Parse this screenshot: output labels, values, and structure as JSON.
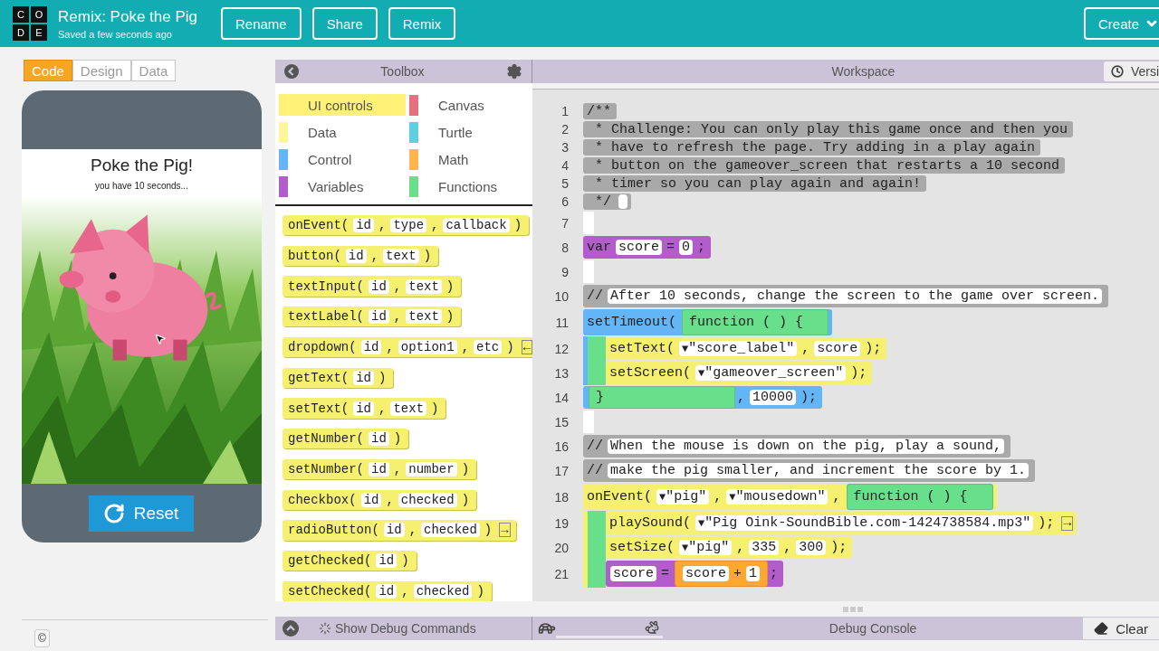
{
  "header": {
    "logo_letters": [
      "C",
      "O",
      "D",
      "E"
    ],
    "title": "Remix: Poke the Pig",
    "subtitle": "Saved a few seconds ago",
    "buttons": [
      "Rename",
      "Share",
      "Remix"
    ],
    "create_button": "Create"
  },
  "view_tabs": [
    {
      "label": "Code",
      "selected": true
    },
    {
      "label": "Design",
      "selected": false
    },
    {
      "label": "Data",
      "selected": false
    }
  ],
  "app_preview": {
    "title": "Poke the Pig!",
    "timer_text": "you have 10 seconds...",
    "reset_button": "Reset",
    "copyright_button": "©"
  },
  "toolbox": {
    "title": "Toolbox",
    "categories": [
      {
        "label": "UI controls",
        "color": "#fff176",
        "selected": true
      },
      {
        "label": "Canvas",
        "color": "#e5707e",
        "selected": false
      },
      {
        "label": "Data",
        "color": "#fff59d",
        "selected": false
      },
      {
        "label": "Turtle",
        "color": "#5ed0e0",
        "selected": false
      },
      {
        "label": "Control",
        "color": "#64b5f6",
        "selected": false
      },
      {
        "label": "Math",
        "color": "#ffb74d",
        "selected": false
      },
      {
        "label": "Variables",
        "color": "#b35ccc",
        "selected": false
      },
      {
        "label": "Functions",
        "color": "#68e08b",
        "selected": false
      }
    ],
    "blocks": [
      [
        {
          "kind": "code",
          "text": "onEvent("
        },
        {
          "kind": "slot",
          "text": "id"
        },
        {
          "kind": "code",
          "text": ","
        },
        {
          "kind": "slot",
          "text": "type"
        },
        {
          "kind": "code",
          "text": ","
        },
        {
          "kind": "slot",
          "text": "callback"
        },
        {
          "kind": "code",
          "text": ")"
        }
      ],
      [
        {
          "kind": "code",
          "text": "button("
        },
        {
          "kind": "slot",
          "text": "id"
        },
        {
          "kind": "code",
          "text": ","
        },
        {
          "kind": "slot",
          "text": "text"
        },
        {
          "kind": "code",
          "text": ")"
        }
      ],
      [
        {
          "kind": "code",
          "text": "textInput("
        },
        {
          "kind": "slot",
          "text": "id"
        },
        {
          "kind": "code",
          "text": ","
        },
        {
          "kind": "slot",
          "text": "text"
        },
        {
          "kind": "code",
          "text": ")"
        }
      ],
      [
        {
          "kind": "code",
          "text": "textLabel("
        },
        {
          "kind": "slot",
          "text": "id"
        },
        {
          "kind": "code",
          "text": ","
        },
        {
          "kind": "slot",
          "text": "text"
        },
        {
          "kind": "code",
          "text": ")"
        }
      ],
      [
        {
          "kind": "code",
          "text": "dropdown("
        },
        {
          "kind": "slot",
          "text": "id"
        },
        {
          "kind": "code",
          "text": ","
        },
        {
          "kind": "slot",
          "text": "option1"
        },
        {
          "kind": "code",
          "text": ","
        },
        {
          "kind": "slot",
          "text": "etc"
        },
        {
          "kind": "code",
          "text": ")"
        },
        {
          "kind": "arrow",
          "text": "←"
        }
      ],
      [
        {
          "kind": "code",
          "text": "getText("
        },
        {
          "kind": "slot",
          "text": "id"
        },
        {
          "kind": "code",
          "text": ")"
        }
      ],
      [
        {
          "kind": "code",
          "text": "setText("
        },
        {
          "kind": "slot",
          "text": "id"
        },
        {
          "kind": "code",
          "text": ","
        },
        {
          "kind": "slot",
          "text": "text"
        },
        {
          "kind": "code",
          "text": ")"
        }
      ],
      [
        {
          "kind": "code",
          "text": "getNumber("
        },
        {
          "kind": "slot",
          "text": "id"
        },
        {
          "kind": "code",
          "text": ")"
        }
      ],
      [
        {
          "kind": "code",
          "text": "setNumber("
        },
        {
          "kind": "slot",
          "text": "id"
        },
        {
          "kind": "code",
          "text": ","
        },
        {
          "kind": "slot",
          "text": "number"
        },
        {
          "kind": "code",
          "text": ")"
        }
      ],
      [
        {
          "kind": "code",
          "text": "checkbox("
        },
        {
          "kind": "slot",
          "text": "id"
        },
        {
          "kind": "code",
          "text": ","
        },
        {
          "kind": "slot",
          "text": "checked"
        },
        {
          "kind": "code",
          "text": ")"
        }
      ],
      [
        {
          "kind": "code",
          "text": "radioButton("
        },
        {
          "kind": "slot",
          "text": "id"
        },
        {
          "kind": "code",
          "text": ","
        },
        {
          "kind": "slot",
          "text": "checked"
        },
        {
          "kind": "code",
          "text": ")"
        },
        {
          "kind": "arrow",
          "text": "→"
        }
      ],
      [
        {
          "kind": "code",
          "text": "getChecked("
        },
        {
          "kind": "slot",
          "text": "id"
        },
        {
          "kind": "code",
          "text": ")"
        }
      ],
      [
        {
          "kind": "code",
          "text": "setChecked("
        },
        {
          "kind": "slot",
          "text": "id"
        },
        {
          "kind": "code",
          "text": ","
        },
        {
          "kind": "slot",
          "text": "checked"
        },
        {
          "kind": "code",
          "text": ")"
        }
      ]
    ]
  },
  "workspace": {
    "title": "Workspace",
    "version_button": "Versi",
    "lines": [
      {
        "number": "1",
        "kind": "doc",
        "tokens": [
          {
            "kind": "code",
            "text": "/**"
          }
        ]
      },
      {
        "number": "2",
        "kind": "doc",
        "tokens": [
          {
            "kind": "code",
            "text": " * Challenge: You can only play this game once and then you"
          }
        ]
      },
      {
        "number": "3",
        "kind": "doc",
        "tokens": [
          {
            "kind": "code",
            "text": " * have to refresh the page. Try adding in a play again"
          }
        ]
      },
      {
        "number": "4",
        "kind": "doc",
        "tokens": [
          {
            "kind": "code",
            "text": " * button on the gameover_screen that restarts a 10 second"
          }
        ]
      },
      {
        "number": "5",
        "kind": "doc",
        "tokens": [
          {
            "kind": "code",
            "text": " * timer so you can play again and again!"
          }
        ]
      },
      {
        "number": "6",
        "kind": "doc",
        "tokens": [
          {
            "kind": "code",
            "text": " */"
          },
          {
            "kind": "blank"
          }
        ]
      },
      {
        "number": "7",
        "kind": "spacer"
      },
      {
        "number": "8",
        "kind": "block",
        "color": "#b35ccc",
        "tokens": [
          {
            "kind": "code",
            "text": "var"
          },
          {
            "kind": "slot",
            "text": "score"
          },
          {
            "kind": "code",
            "text": "="
          },
          {
            "kind": "slot",
            "text": "0"
          },
          {
            "kind": "code",
            "text": ";"
          }
        ]
      },
      {
        "number": "9",
        "kind": "spacer"
      },
      {
        "number": "10",
        "kind": "block",
        "color": "#a9a9a9",
        "tokens": [
          {
            "kind": "code",
            "text": "//"
          },
          {
            "kind": "slot",
            "text": "After 10 seconds, change the screen to the game over screen."
          }
        ]
      },
      {
        "number": "11",
        "kind": "block",
        "color": "#64b5f6",
        "tokens": [
          {
            "kind": "code",
            "text": "setTimeout("
          },
          {
            "kind": "block",
            "color": "#68e08b",
            "tokens": [
              {
                "kind": "code",
                "text": "function ( ) {"
              }
            ]
          }
        ],
        "children": [
          {
            "number": "12",
            "kind": "block",
            "color": "#f6f070",
            "tokens": [
              {
                "kind": "code",
                "text": "setText("
              },
              {
                "kind": "dropdown",
                "arrow": "▼",
                "text": "\"score_label\""
              },
              {
                "kind": "code",
                "text": ","
              },
              {
                "kind": "slot",
                "text": "score"
              },
              {
                "kind": "code",
                "text": ");"
              }
            ]
          },
          {
            "number": "13",
            "kind": "block",
            "color": "#f6f070",
            "tokens": [
              {
                "kind": "code",
                "text": "setScreen("
              },
              {
                "kind": "dropdown",
                "arrow": "▼",
                "text": "\"gameover_screen\""
              },
              {
                "kind": "code",
                "text": ");"
              }
            ]
          }
        ],
        "footer": {
          "number": "14",
          "inner": [
            {
              "kind": "code",
              "text": "}"
            }
          ],
          "outer": [
            {
              "kind": "code",
              "text": ","
            },
            {
              "kind": "slot",
              "text": "10000"
            },
            {
              "kind": "code",
              "text": ");"
            }
          ]
        }
      },
      {
        "number": "15",
        "kind": "spacer"
      },
      {
        "number": "16",
        "kind": "block",
        "color": "#a9a9a9",
        "tokens": [
          {
            "kind": "code",
            "text": "//"
          },
          {
            "kind": "slot",
            "text": "When the mouse is down on the pig, play a sound,"
          }
        ]
      },
      {
        "number": "17",
        "kind": "block",
        "color": "#a9a9a9",
        "tokens": [
          {
            "kind": "code",
            "text": "//"
          },
          {
            "kind": "slot",
            "text": "make the pig smaller, and increment the score by 1."
          }
        ]
      },
      {
        "number": "18",
        "kind": "block",
        "color": "#f6f070",
        "tokens": [
          {
            "kind": "code",
            "text": "onEvent("
          },
          {
            "kind": "dropdown",
            "arrow": "▼",
            "text": "\"pig\""
          },
          {
            "kind": "code",
            "text": ","
          },
          {
            "kind": "dropdown",
            "arrow": "▼",
            "text": "\"mousedown\""
          },
          {
            "kind": "code",
            "text": ","
          },
          {
            "kind": "block",
            "color": "#68e08b",
            "tokens": [
              {
                "kind": "code",
                "text": "function ( ) {"
              }
            ]
          }
        ],
        "children": [
          {
            "number": "19",
            "kind": "block",
            "color": "#f6f070",
            "tokens": [
              {
                "kind": "code",
                "text": "playSound("
              },
              {
                "kind": "dropdown",
                "arrow": "▼",
                "text": "\"Pig Oink-SoundBible.com-1424738584.mp3\""
              },
              {
                "kind": "code",
                "text": ");"
              },
              {
                "kind": "arrow",
                "text": "→"
              }
            ]
          },
          {
            "number": "20",
            "kind": "block",
            "color": "#f6f070",
            "tokens": [
              {
                "kind": "code",
                "text": "setSize("
              },
              {
                "kind": "dropdown",
                "arrow": "▼",
                "text": "\"pig\""
              },
              {
                "kind": "code",
                "text": ","
              },
              {
                "kind": "slot",
                "text": "335"
              },
              {
                "kind": "code",
                "text": ","
              },
              {
                "kind": "slot",
                "text": "300"
              },
              {
                "kind": "code",
                "text": ");"
              }
            ]
          },
          {
            "number": "21",
            "kind": "block",
            "color": "#b35ccc",
            "tokens": [
              {
                "kind": "slot",
                "text": "score"
              },
              {
                "kind": "code",
                "text": "="
              },
              {
                "kind": "block",
                "color": "#ffa733",
                "tokens": [
                  {
                    "kind": "slot",
                    "text": "score"
                  },
                  {
                    "kind": "code",
                    "text": "+"
                  },
                  {
                    "kind": "slot",
                    "text": "1"
                  }
                ]
              },
              {
                "kind": "code",
                "text": ";"
              }
            ]
          }
        ]
      }
    ]
  },
  "debug": {
    "show_commands": "Show Debug Commands",
    "speed": {
      "level": 0.9
    },
    "console_title": "Debug Console",
    "clear_button": "Clear"
  }
}
